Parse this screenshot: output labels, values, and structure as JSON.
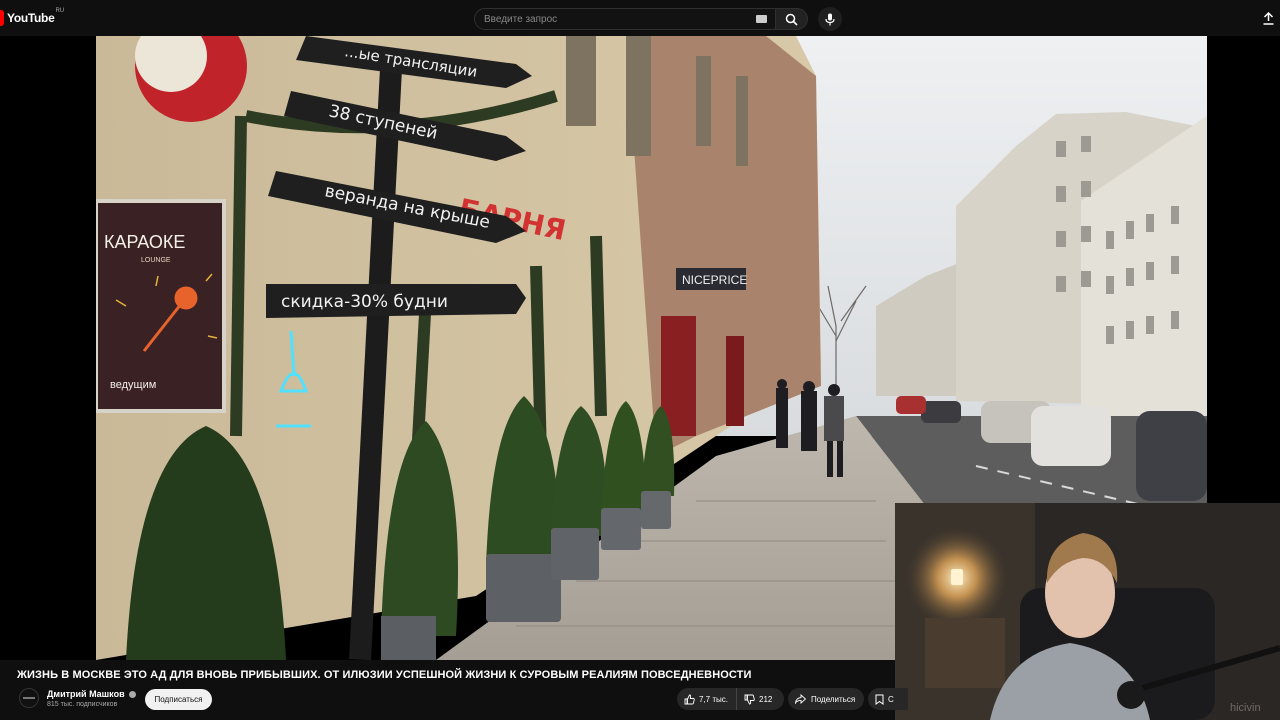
{
  "header": {
    "logo_text": "YouTube",
    "region": "RU",
    "search_placeholder": "Введите запрос"
  },
  "scene": {
    "signs": [
      "...ые трансляции",
      "38 ступеней",
      "веранда на крыше",
      "скидка-30% будни"
    ],
    "lightbox": {
      "title": "КАРАОКЕ",
      "subtitle": "LOUNGE",
      "footer": "ведущим"
    },
    "storefront_sign": "...БАРНЯ",
    "shop_sign": "NICEPRICE",
    "watermark": "hicivin"
  },
  "video": {
    "title": "ЖИЗНЬ В МОСКВЕ ЭТО АД ДЛЯ ВНОВЬ ПРИБЫВШИХ. ОТ ИЛЮЗИИ УСПЕШНОЙ ЖИЗНИ К СУРОВЫМ РЕАЛИЯМ ПОВСЕДНЕВНОСТИ",
    "channel": "Дмитрий Машков",
    "subscribers": "815 тыс. подписчиков",
    "subscribe_label": "Подписаться",
    "likes": "7,7 тыс.",
    "dislikes": "212",
    "share_label": "Поделиться",
    "save_label": "С"
  },
  "colors": {
    "background": "#0f0f0f",
    "brand_red": "#ff0000",
    "pill": "#272727"
  }
}
